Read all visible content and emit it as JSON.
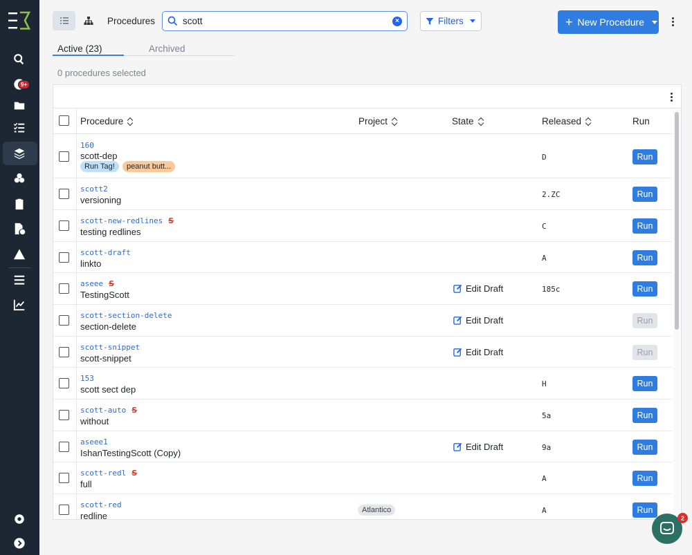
{
  "sidebar": {
    "notification_badge": "9+",
    "icons": [
      "search-icon",
      "notifications-icon",
      "folder-icon",
      "checklist-icon",
      "procedures-icon",
      "components-icon",
      "clipboard-icon",
      "clock-file-icon",
      "alert-icon",
      "menu-icon",
      "analytics-icon",
      "settings-icon",
      "expand-icon"
    ]
  },
  "header": {
    "breadcrumb": "Procedures",
    "search": {
      "value": "scott",
      "placeholder": ""
    },
    "filters_label": "Filters",
    "new_button_label": "New Procedure"
  },
  "tabs": [
    {
      "label": "Active (23)",
      "active": true
    },
    {
      "label": "Archived",
      "active": false
    }
  ],
  "selection_status": "0 procedures selected",
  "table": {
    "columns": [
      "Procedure",
      "Project",
      "State",
      "Released",
      "Run"
    ],
    "rows": [
      {
        "id": "160",
        "name": "scott-dep",
        "tags": [
          "Run Tag!",
          "peanut butt..."
        ],
        "project": "",
        "state": "",
        "released": "D",
        "run": "Run",
        "run_enabled": true,
        "strike": false
      },
      {
        "id": "scott2",
        "name": "versioning",
        "tags": [],
        "project": "",
        "state": "",
        "released": "2.ZC",
        "run": "Run",
        "run_enabled": true,
        "strike": false
      },
      {
        "id": "scott-new-redlines",
        "name": "testing redlines",
        "tags": [],
        "project": "",
        "state": "",
        "released": "C",
        "run": "Run",
        "run_enabled": true,
        "strike": true
      },
      {
        "id": "scott-draft",
        "name": "linkto",
        "tags": [],
        "project": "",
        "state": "",
        "released": "A",
        "run": "Run",
        "run_enabled": true,
        "strike": false
      },
      {
        "id": "aseee",
        "name": "TestingScott",
        "tags": [],
        "project": "",
        "state": "Edit Draft",
        "released": "185c",
        "run": "Run",
        "run_enabled": true,
        "strike": true
      },
      {
        "id": "scott-section-delete",
        "name": "section-delete",
        "tags": [],
        "project": "",
        "state": "Edit Draft",
        "released": "",
        "run": "Run",
        "run_enabled": false,
        "strike": false
      },
      {
        "id": "scott-snippet",
        "name": "scott-snippet",
        "tags": [],
        "project": "",
        "state": "Edit Draft",
        "released": "",
        "run": "Run",
        "run_enabled": false,
        "strike": false
      },
      {
        "id": "153",
        "name": "scott sect dep",
        "tags": [],
        "project": "",
        "state": "",
        "released": "H",
        "run": "Run",
        "run_enabled": true,
        "strike": false
      },
      {
        "id": "scott-auto",
        "name": "without",
        "tags": [],
        "project": "",
        "state": "",
        "released": "5a",
        "run": "Run",
        "run_enabled": true,
        "strike": true
      },
      {
        "id": "aseee1",
        "name": "IshanTestingScott (Copy)",
        "tags": [],
        "project": "",
        "state": "Edit Draft",
        "released": "9a",
        "run": "Run",
        "run_enabled": true,
        "strike": false
      },
      {
        "id": "scott-redl",
        "name": "full",
        "tags": [],
        "project": "",
        "state": "",
        "released": "A",
        "run": "Run",
        "run_enabled": true,
        "strike": true
      },
      {
        "id": "scott-red",
        "name": "redline",
        "tags": [],
        "project": "Atlantico",
        "state": "",
        "released": "A",
        "run": "Run",
        "run_enabled": true,
        "strike": false
      }
    ]
  },
  "chat": {
    "badge": "2"
  },
  "colors": {
    "sidebar": "#1d2733",
    "accent": "#2f7de1",
    "link": "#2f6bc4",
    "redline": "#d23c32"
  }
}
